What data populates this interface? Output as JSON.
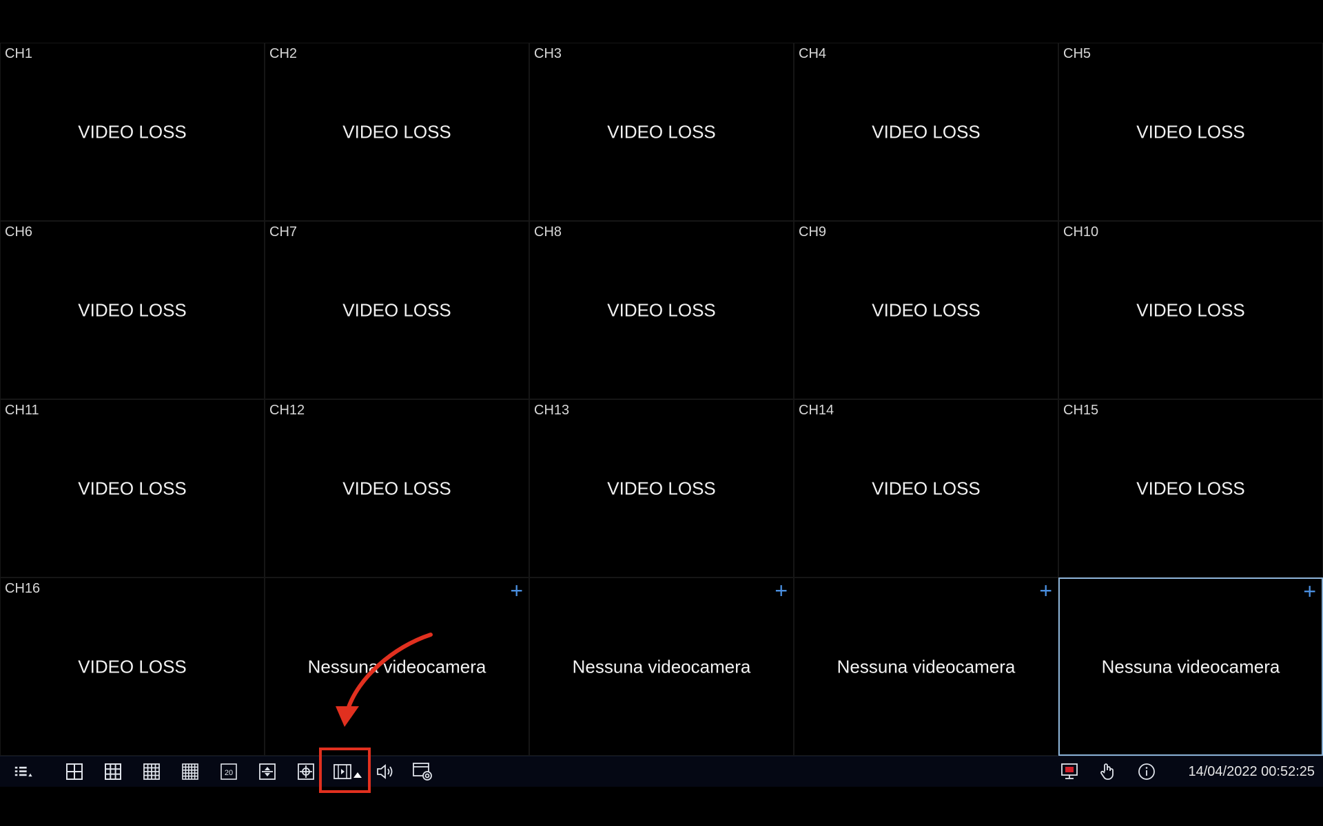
{
  "channels": [
    {
      "label": "CH1",
      "status": "VIDEO LOSS"
    },
    {
      "label": "CH2",
      "status": "VIDEO LOSS"
    },
    {
      "label": "CH3",
      "status": "VIDEO LOSS"
    },
    {
      "label": "CH4",
      "status": "VIDEO LOSS"
    },
    {
      "label": "CH5",
      "status": "VIDEO LOSS"
    },
    {
      "label": "CH6",
      "status": "VIDEO LOSS"
    },
    {
      "label": "CH7",
      "status": "VIDEO LOSS"
    },
    {
      "label": "CH8",
      "status": "VIDEO LOSS"
    },
    {
      "label": "CH9",
      "status": "VIDEO LOSS"
    },
    {
      "label": "CH10",
      "status": "VIDEO LOSS"
    },
    {
      "label": "CH11",
      "status": "VIDEO LOSS"
    },
    {
      "label": "CH12",
      "status": "VIDEO LOSS"
    },
    {
      "label": "CH13",
      "status": "VIDEO LOSS"
    },
    {
      "label": "CH14",
      "status": "VIDEO LOSS"
    },
    {
      "label": "CH15",
      "status": "VIDEO LOSS"
    },
    {
      "label": "CH16",
      "status": "VIDEO LOSS"
    }
  ],
  "empty_slots": [
    {
      "status": "Nessuna videocamera",
      "add_symbol": "+"
    },
    {
      "status": "Nessuna videocamera",
      "add_symbol": "+"
    },
    {
      "status": "Nessuna videocamera",
      "add_symbol": "+"
    },
    {
      "status": "Nessuna videocamera",
      "add_symbol": "+"
    }
  ],
  "toolbar": {
    "layout_20_label": "20",
    "datetime": "14/04/2022 00:52:25",
    "icons": [
      "menu-icon",
      "layout-4-icon",
      "layout-9-icon",
      "layout-16-icon",
      "layout-25-icon",
      "layout-20-icon",
      "ptz-icon",
      "zoom-icon",
      "playback-icon",
      "audio-icon",
      "snapshot-icon",
      "monitor-icon",
      "hand-icon",
      "info-icon"
    ]
  },
  "annotation": {
    "highlight_color": "#e1301f",
    "arrow_color": "#e1301f"
  },
  "colors": {
    "accent": "#4a8fe0",
    "selected_border": "#8ab1d6"
  }
}
